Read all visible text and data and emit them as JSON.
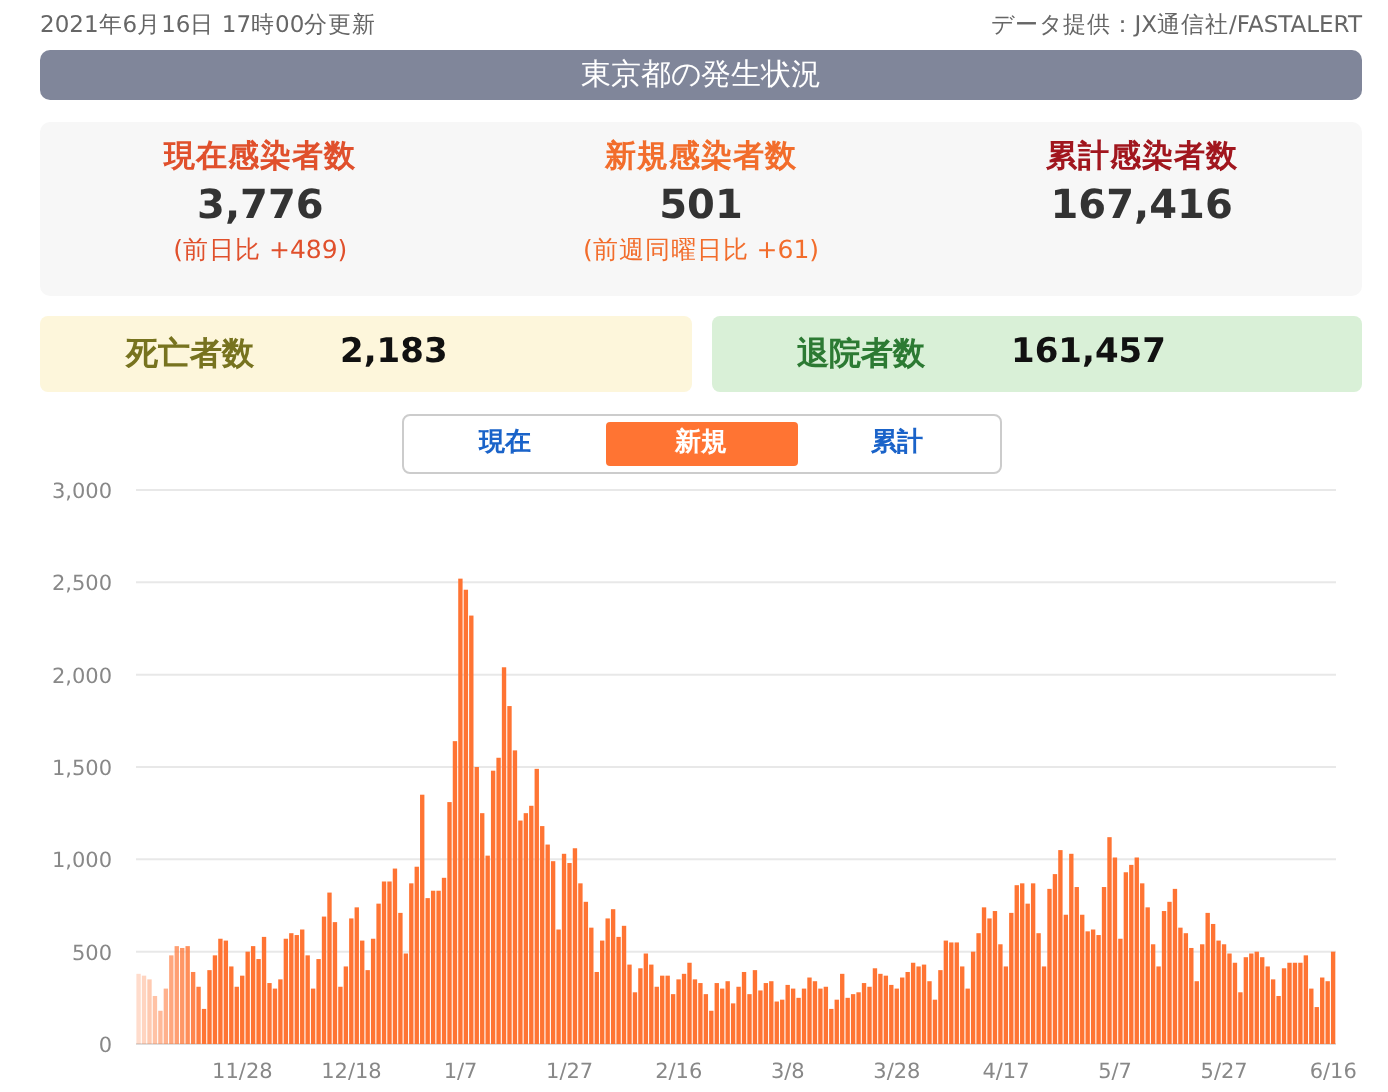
{
  "header": {
    "updated": "2021年6月16日 17時00分更新",
    "source": "データ提供：JX通信社/FASTALERT"
  },
  "title": "東京都の発生状況",
  "stats": [
    {
      "label": "現在感染者数",
      "value": "3,776",
      "change": "(前日比 +489)",
      "color": "#e0502c"
    },
    {
      "label": "新規感染者数",
      "value": "501",
      "change": "(前週同曜日比 +61)",
      "color": "#f26d2c"
    },
    {
      "label": "累計感染者数",
      "value": "167,416",
      "color": "#a1161e"
    }
  ],
  "totals": [
    {
      "kind": "deaths",
      "label": "死亡者数",
      "value": "2,183"
    },
    {
      "kind": "recovered",
      "label": "退院者数",
      "value": "161,457"
    }
  ],
  "view_tabs": [
    {
      "label": "現在",
      "selected": false
    },
    {
      "label": "新規",
      "selected": true
    },
    {
      "label": "累計",
      "selected": false
    }
  ],
  "chart": {
    "chart_data": {
      "type": "bar",
      "ylim": [
        0,
        3000
      ],
      "yticks": [
        {
          "value": 0,
          "label": "0"
        },
        {
          "value": 500,
          "label": "500"
        },
        {
          "value": 1000,
          "label": "1,000"
        },
        {
          "value": 1500,
          "label": "1,500"
        },
        {
          "value": 2000,
          "label": "2,000"
        },
        {
          "value": 2500,
          "label": "2,500"
        },
        {
          "value": 3000,
          "label": "3,000"
        }
      ],
      "grid": true,
      "categories": [
        null,
        null,
        null,
        null,
        null,
        null,
        null,
        null,
        null,
        null,
        null,
        null,
        null,
        null,
        null,
        null,
        null,
        null,
        null,
        "11/28",
        null,
        null,
        null,
        null,
        null,
        null,
        null,
        null,
        null,
        null,
        null,
        null,
        null,
        null,
        null,
        null,
        null,
        null,
        null,
        "12/18",
        null,
        null,
        null,
        null,
        null,
        null,
        null,
        null,
        null,
        null,
        null,
        null,
        null,
        null,
        null,
        null,
        null,
        null,
        null,
        "1/7",
        null,
        null,
        null,
        null,
        null,
        null,
        null,
        null,
        null,
        null,
        null,
        null,
        null,
        null,
        null,
        null,
        null,
        null,
        null,
        "1/27",
        null,
        null,
        null,
        null,
        null,
        null,
        null,
        null,
        null,
        null,
        null,
        null,
        null,
        null,
        null,
        null,
        null,
        null,
        null,
        "2/16",
        null,
        null,
        null,
        null,
        null,
        null,
        null,
        null,
        null,
        null,
        null,
        null,
        null,
        null,
        null,
        null,
        null,
        null,
        null,
        "3/8",
        null,
        null,
        null,
        null,
        null,
        null,
        null,
        null,
        null,
        null,
        null,
        null,
        null,
        null,
        null,
        null,
        null,
        null,
        null,
        "3/28",
        null,
        null,
        null,
        null,
        null,
        null,
        null,
        null,
        null,
        null,
        null,
        null,
        null,
        null,
        null,
        null,
        null,
        null,
        null,
        "4/17",
        null,
        null,
        null,
        null,
        null,
        null,
        null,
        null,
        null,
        null,
        null,
        null,
        null,
        null,
        null,
        null,
        null,
        null,
        null,
        "5/7",
        null,
        null,
        null,
        null,
        null,
        null,
        null,
        null,
        null,
        null,
        null,
        null,
        null,
        null,
        null,
        null,
        null,
        null,
        null,
        "5/27",
        null,
        null,
        null,
        null,
        null,
        null,
        null,
        null,
        null,
        null,
        null,
        null,
        null,
        null,
        null,
        null,
        null,
        null,
        null,
        "6/16"
      ],
      "series": [
        {
          "color": "#ff7433",
          "values": [
            380,
            370,
            350,
            260,
            180,
            300,
            480,
            530,
            520,
            530,
            390,
            310,
            190,
            400,
            480,
            570,
            560,
            420,
            310,
            370,
            500,
            530,
            460,
            580,
            330,
            300,
            350,
            570,
            600,
            590,
            620,
            480,
            300,
            460,
            690,
            820,
            660,
            310,
            420,
            680,
            740,
            560,
            400,
            570,
            760,
            880,
            880,
            950,
            710,
            490,
            870,
            960,
            1350,
            790,
            830,
            830,
            900,
            1310,
            1640,
            2520,
            2460,
            2320,
            1500,
            1250,
            1020,
            1480,
            1550,
            2040,
            1830,
            1590,
            1210,
            1250,
            1290,
            1490,
            1180,
            1080,
            990,
            620,
            1030,
            980,
            1060,
            870,
            770,
            630,
            390,
            560,
            680,
            730,
            580,
            640,
            430,
            280,
            410,
            490,
            430,
            310,
            370,
            370,
            270,
            350,
            380,
            440,
            350,
            330,
            270,
            180,
            330,
            300,
            340,
            220,
            310,
            390,
            270,
            400,
            290,
            330,
            340,
            230,
            240,
            320,
            300,
            250,
            300,
            360,
            340,
            300,
            310,
            190,
            240,
            380,
            250,
            270,
            280,
            330,
            310,
            410,
            380,
            370,
            320,
            300,
            360,
            390,
            440,
            420,
            430,
            340,
            240,
            400,
            560,
            550,
            550,
            420,
            300,
            500,
            600,
            740,
            680,
            720,
            540,
            420,
            710,
            860,
            870,
            760,
            870,
            600,
            420,
            840,
            920,
            1050,
            700,
            1030,
            850,
            700,
            610,
            620,
            590,
            850,
            1120,
            1010,
            570,
            930,
            970,
            1010,
            870,
            740,
            540,
            420,
            720,
            770,
            840,
            630,
            600,
            520,
            340,
            540,
            710,
            650,
            560,
            540,
            490,
            440,
            280,
            470,
            490,
            500,
            470,
            420,
            350,
            260,
            410,
            440,
            440,
            440,
            480,
            300,
            200,
            360,
            340,
            500
          ]
        }
      ]
    }
  }
}
